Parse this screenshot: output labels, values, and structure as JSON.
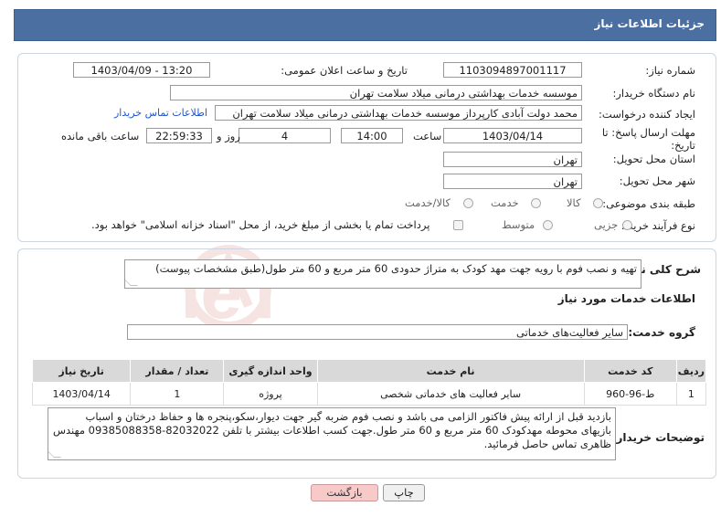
{
  "header": {
    "title": "جزئیات اطلاعات نیاز"
  },
  "need_info": {
    "need_number_label": "شماره نیاز:",
    "need_number": "1103094897001117",
    "announce_label": "تاریخ و ساعت اعلان عمومی:",
    "announce_value": "1403/04/09 - 13:20",
    "buyer_label": "نام دستگاه خریدار:",
    "buyer_value": "موسسه خدمات بهداشتی درمانی میلاد سلامت تهران",
    "creator_label": "ایجاد کننده درخواست:",
    "creator_value": "محمد دولت آبادی کارپرداز موسسه خدمات بهداشتی درمانی میلاد سلامت تهران",
    "contact_link": "اطلاعات تماس خریدار",
    "deadline_label_1": "مهلت ارسال پاسخ: تا",
    "deadline_label_2": "تاریخ:",
    "deadline_date": "1403/04/14",
    "time_label": "ساعت",
    "deadline_time": "14:00",
    "days_value": "4",
    "days_label": "روز و",
    "remaining_value": "22:59:33",
    "remaining_label": "ساعت باقی مانده",
    "province_label": "استان محل تحویل:",
    "province_value": "تهران",
    "city_label": "شهر محل تحویل:",
    "city_value": "تهران",
    "category_label": "طبقه بندی موضوعی:",
    "category_options": [
      "کالا",
      "خدمت",
      "کالا/خدمت"
    ],
    "process_label": "نوع فرآیند خرید :",
    "process_options": [
      "جزیی",
      "متوسط"
    ],
    "payment_note": "پرداخت تمام یا بخشی از مبلغ خرید، از محل \"اسناد خزانه اسلامی\" خواهد بود."
  },
  "description": {
    "label": "شرح کلی نیاز:",
    "value": "تهیه و نصب فوم با رویه جهت مهد کودک به متراژ حدودی 60 متر مربع و 60 متر طول(طبق مشخصات پیوست)"
  },
  "services": {
    "section_title": "اطلاعات خدمات مورد نیاز",
    "group_label": "گروه خدمت:",
    "group_value": "سایر فعالیت‌های خدماتی",
    "columns": [
      "ردیف",
      "کد خدمت",
      "نام خدمت",
      "واحد اندازه گیری",
      "تعداد / مقدار",
      "تاریخ نیاز"
    ],
    "rows": [
      [
        "1",
        "ط-96-960",
        "سایر فعالیت های خدماتی شخصی",
        "پروژه",
        "1",
        "1403/04/14"
      ]
    ]
  },
  "buyer_notes": {
    "label": "توضیحات خریدار:",
    "line1": "بازدید قبل از ارائه پیش فاکتور الزامی می باشد و نصب فوم ضربه گیر جهت دیوار،سکو،پنجره ها و حفاظ درختان و اسباب",
    "line2": "بازیهای محوطه مهدکودک 60 متر مربع و 60 متر طول.جهت کسب اطلاعات بیشتر با تلفن 82032022-09385088358 مهندس",
    "line3": "ظاهری تماس حاصل فرمائید."
  },
  "buttons": {
    "print": "چاپ",
    "back": "بازگشت"
  },
  "watermark": {
    "text": "AriaTender.neT"
  },
  "colors": {
    "header_bg": "#4a6fa0",
    "link": "#2255cc",
    "back_btn": "#f7c9c9",
    "watermark": "#c0392b"
  }
}
